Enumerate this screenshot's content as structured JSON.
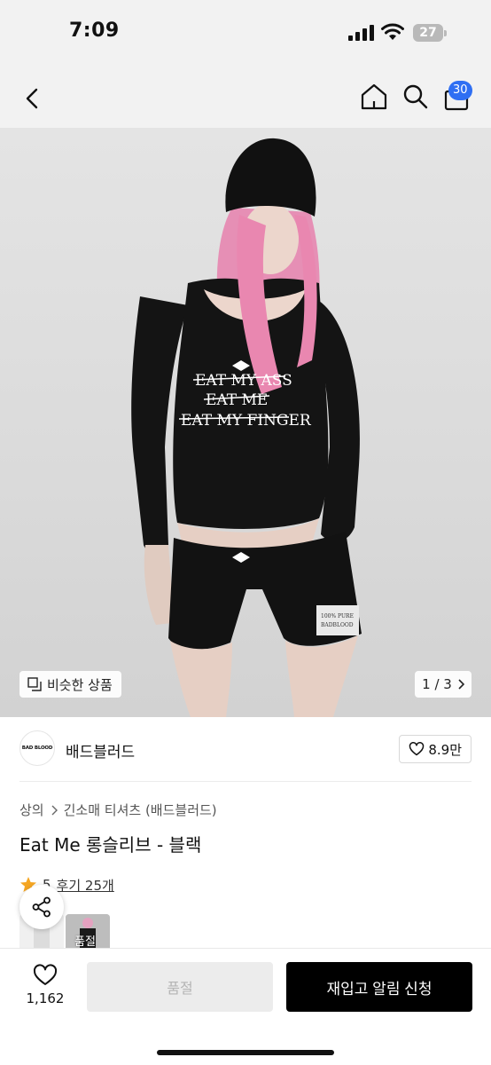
{
  "status_bar": {
    "time": "7:09",
    "battery": "27"
  },
  "nav": {
    "back_icon": "chevron-left-icon",
    "home_icon": "home-icon",
    "search_icon": "search-icon",
    "cart_icon": "shopping-bag-icon",
    "cart_count": "30"
  },
  "image": {
    "shirt_lines": [
      "EAT MY ASS",
      "EAT ME",
      "EAT MY FINGER"
    ],
    "shorts_tag": [
      "100% PURE",
      "BADBLOOD"
    ],
    "similar_label": "비슷한 상품",
    "pager": "1 / 3"
  },
  "brand": {
    "logo_text": "BAD BLOOD",
    "name": "배드블러드",
    "likes": "8.9만"
  },
  "breadcrumb": [
    "상의",
    "긴소매 티셔츠 (배드블러드)"
  ],
  "product": {
    "title": "Eat Me 롱슬리브 - 블랙",
    "rating": "5",
    "reviews": "후기 25개"
  },
  "thumbnails": {
    "second_label": "품절"
  },
  "bottom": {
    "wish_count": "1,162",
    "soldout_label": "품절",
    "restock_label": "재입고 알림 신청"
  },
  "colors": {
    "accent_badge": "#2f6ff3",
    "star": "#f5a623",
    "primary_button": "#000000",
    "disabled_button": "#ececec"
  }
}
